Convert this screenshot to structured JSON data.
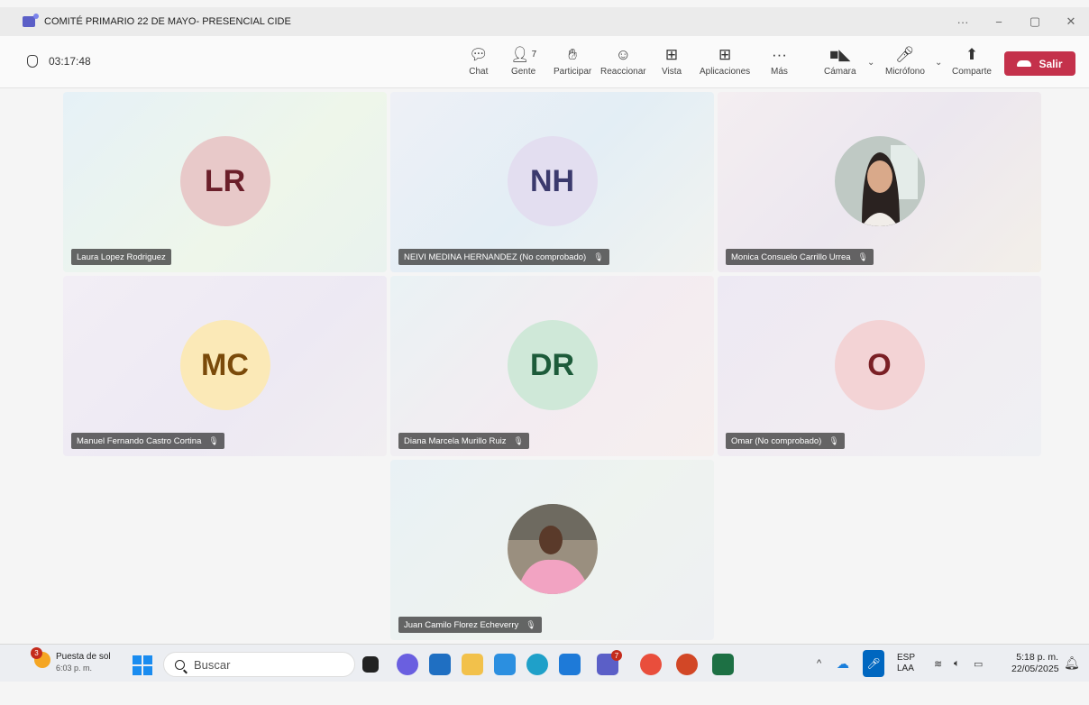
{
  "window": {
    "title": "COMITÉ PRIMARIO 22 DE MAYO- PRESENCIAL CIDE",
    "controls": [
      "···",
      "−",
      "▢",
      "✕"
    ]
  },
  "toolbar": {
    "timer": "03:17:48",
    "chat": "Chat",
    "people": "Gente",
    "people_count": "7",
    "raise": "Participar",
    "react": "Reaccionar",
    "view": "Vista",
    "apps": "Aplicaciones",
    "more": "Más",
    "camera": "Cámara",
    "mic": "Micrófono",
    "share": "Comparte",
    "leave": "Salir"
  },
  "participants": [
    {
      "name": "Laura Lopez Rodriguez",
      "initials": "LR",
      "muted": false,
      "avatar_color": "#e8c9c9",
      "text_color": "#6b1f2a"
    },
    {
      "name": "NEIVI MEDINA HERNANDEZ (No comprobado)",
      "initials": "NH",
      "muted": true,
      "avatar_color": "#e3def0",
      "text_color": "#3b3a6d"
    },
    {
      "name": "Monica Consuelo Carrillo Urrea",
      "initials": "",
      "muted": true,
      "photo": true
    },
    {
      "name": "Manuel Fernando Castro Cortina",
      "initials": "MC",
      "muted": true,
      "avatar_color": "#fbe9b7",
      "text_color": "#7a4a0a"
    },
    {
      "name": "Diana Marcela Murillo Ruiz",
      "initials": "DR",
      "muted": true,
      "avatar_color": "#cfe8d8",
      "text_color": "#1d5b3a"
    },
    {
      "name": "Omar (No comprobado)",
      "initials": "O",
      "muted": true,
      "avatar_color": "#f3d3d5",
      "text_color": "#7a1f25"
    },
    {
      "name": "Juan Camilo Florez Echeverry",
      "initials": "",
      "muted": true,
      "photo": true
    }
  ],
  "taskbar": {
    "weather_title": "Puesta de sol",
    "weather_time": "6:03 p. m.",
    "weather_badge": "3",
    "search_placeholder": "Buscar",
    "teams_badge": "7",
    "lang_top": "ESP",
    "lang_bottom": "LAA",
    "time": "5:18 p. m.",
    "date": "22/05/2025"
  }
}
